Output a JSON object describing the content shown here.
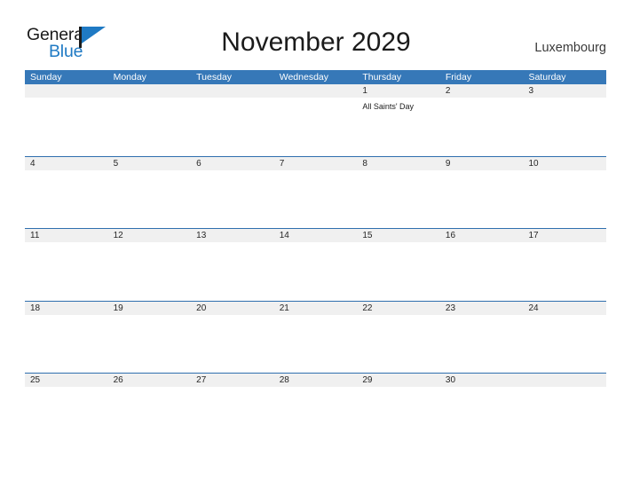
{
  "brand": {
    "name_part1": "General",
    "name_part2": "Blue",
    "flag_icon": "flag-icon",
    "accent_color": "#1f7ac4"
  },
  "header": {
    "title": "November 2029",
    "location": "Luxembourg"
  },
  "theme": {
    "header_blue": "#3678b8",
    "separator_blue": "#2f6fae",
    "band_gray": "#f0f0f0",
    "page_background": "#ffffff",
    "text_dark": "#1b1b1b"
  },
  "calendar": {
    "month": "November",
    "year": "2029",
    "weekday_headers": [
      "Sunday",
      "Monday",
      "Tuesday",
      "Wednesday",
      "Thursday",
      "Friday",
      "Saturday"
    ],
    "weeks": [
      {
        "days": [
          {
            "number": "",
            "event": ""
          },
          {
            "number": "",
            "event": ""
          },
          {
            "number": "",
            "event": ""
          },
          {
            "number": "",
            "event": ""
          },
          {
            "number": "1",
            "event": "All Saints' Day"
          },
          {
            "number": "2",
            "event": ""
          },
          {
            "number": "3",
            "event": ""
          }
        ]
      },
      {
        "days": [
          {
            "number": "4",
            "event": ""
          },
          {
            "number": "5",
            "event": ""
          },
          {
            "number": "6",
            "event": ""
          },
          {
            "number": "7",
            "event": ""
          },
          {
            "number": "8",
            "event": ""
          },
          {
            "number": "9",
            "event": ""
          },
          {
            "number": "10",
            "event": ""
          }
        ]
      },
      {
        "days": [
          {
            "number": "11",
            "event": ""
          },
          {
            "number": "12",
            "event": ""
          },
          {
            "number": "13",
            "event": ""
          },
          {
            "number": "14",
            "event": ""
          },
          {
            "number": "15",
            "event": ""
          },
          {
            "number": "16",
            "event": ""
          },
          {
            "number": "17",
            "event": ""
          }
        ]
      },
      {
        "days": [
          {
            "number": "18",
            "event": ""
          },
          {
            "number": "19",
            "event": ""
          },
          {
            "number": "20",
            "event": ""
          },
          {
            "number": "21",
            "event": ""
          },
          {
            "number": "22",
            "event": ""
          },
          {
            "number": "23",
            "event": ""
          },
          {
            "number": "24",
            "event": ""
          }
        ]
      },
      {
        "days": [
          {
            "number": "25",
            "event": ""
          },
          {
            "number": "26",
            "event": ""
          },
          {
            "number": "27",
            "event": ""
          },
          {
            "number": "28",
            "event": ""
          },
          {
            "number": "29",
            "event": ""
          },
          {
            "number": "30",
            "event": ""
          },
          {
            "number": "",
            "event": ""
          }
        ]
      }
    ]
  }
}
